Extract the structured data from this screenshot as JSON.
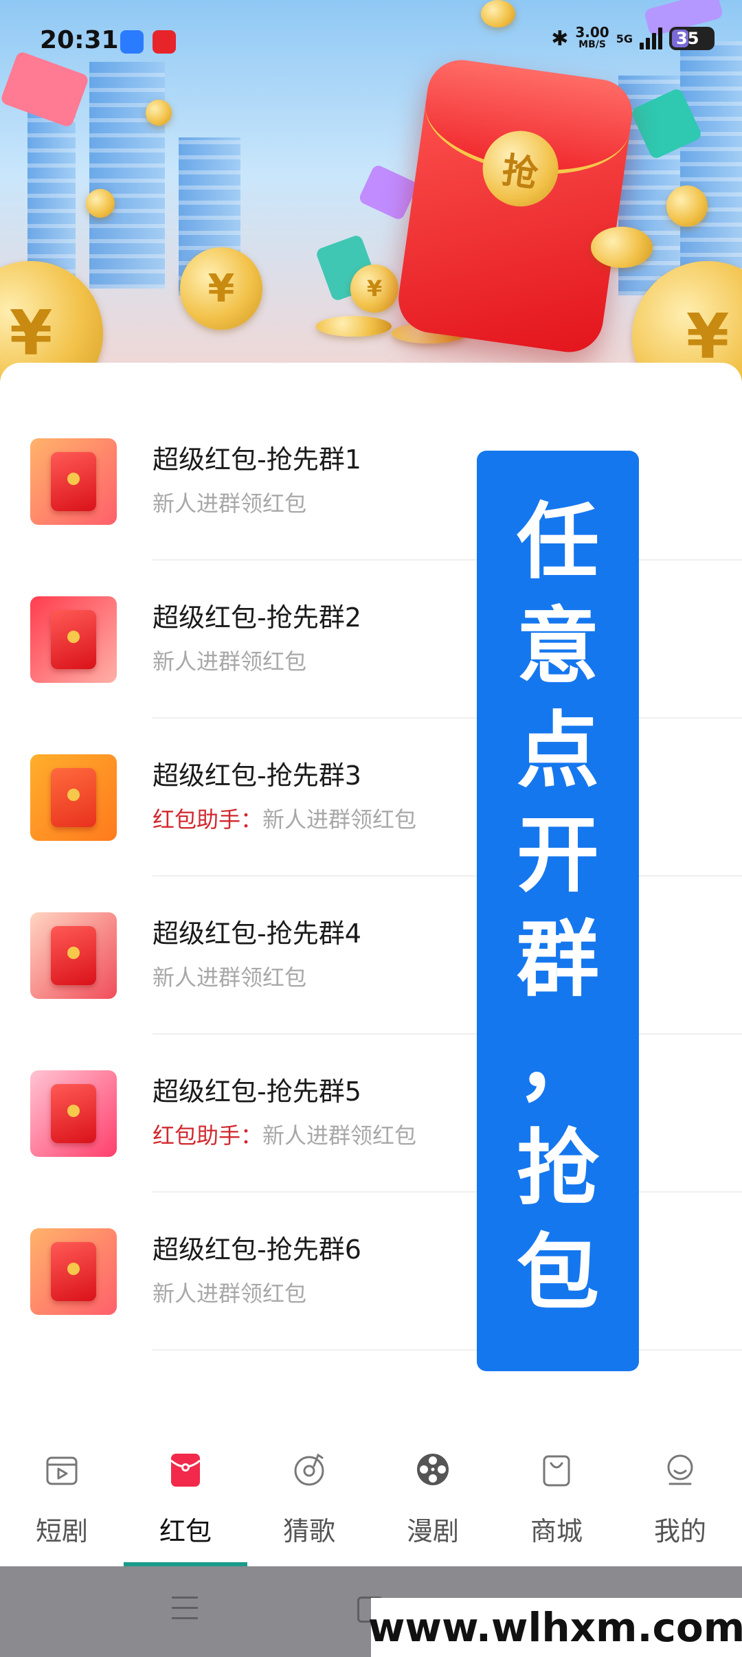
{
  "status_bar": {
    "time": "20:31",
    "network_speed": "3.00",
    "network_unit": "MB/S",
    "network_type": "5G",
    "battery": "35"
  },
  "hero": {
    "packet_seal_text": "抢",
    "coin_symbol": "¥"
  },
  "groups": [
    {
      "title": "超级红包-抢先群1",
      "tag": "",
      "subtitle": "新人进群领红包"
    },
    {
      "title": "超级红包-抢先群2",
      "tag": "",
      "subtitle": "新人进群领红包"
    },
    {
      "title": "超级红包-抢先群3",
      "tag": "红包助手：",
      "subtitle": "新人进群领红包"
    },
    {
      "title": "超级红包-抢先群4",
      "tag": "",
      "subtitle": "新人进群领红包"
    },
    {
      "title": "超级红包-抢先群5",
      "tag": "红包助手：",
      "subtitle": "新人进群领红包"
    },
    {
      "title": "超级红包-抢先群6",
      "tag": "",
      "subtitle": "新人进群领红包"
    }
  ],
  "overlay_chars": [
    "任",
    "意",
    "点",
    "开",
    "群",
    "，",
    "抢",
    "包"
  ],
  "tabs": [
    {
      "label": "短剧",
      "icon": "play-card-icon",
      "active": false
    },
    {
      "label": "红包",
      "icon": "red-packet-icon",
      "active": true
    },
    {
      "label": "猜歌",
      "icon": "music-disc-icon",
      "active": false
    },
    {
      "label": "漫剧",
      "icon": "film-reel-icon",
      "active": false
    },
    {
      "label": "商城",
      "icon": "shopping-bag-icon",
      "active": false
    },
    {
      "label": "我的",
      "icon": "profile-icon",
      "active": false
    }
  ],
  "watermark": "www.wlhxm.com",
  "colors": {
    "accent_blue": "#1577ee",
    "tag_red": "#d0282e",
    "tab_underline": "#1a9b8a"
  }
}
